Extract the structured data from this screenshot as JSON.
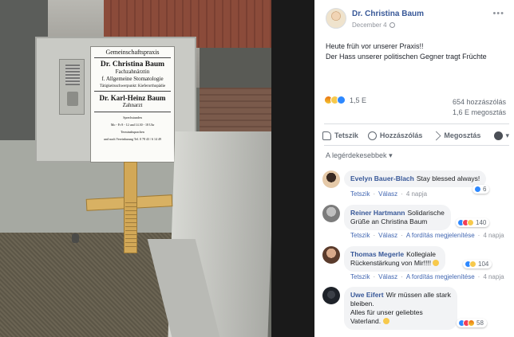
{
  "photo": {
    "sign": {
      "header": "Gemeinschaftspraxis",
      "doctor1_name": "Dr. Christina Baum",
      "doctor1_title_line1": "Fachzahnärztin",
      "doctor1_title_line2": "f. Allgemeine Stomatologie",
      "doctor1_note": "Tätigkeitsschwerpunkt: Kieferorthopädie",
      "doctor2_name": "Dr. Karl-Heinz Baum",
      "doctor2_title": "Zahnarzt",
      "hours_heading": "Sprechstunden",
      "hours_line1": "Mo - Fr   8 - 12 und 14.30 - 18 Uhr",
      "hours_line2": "Terminabsprachen",
      "hours_line3": "und nach Vereinbarung   Tel. 0 78 43 / 6 14 49"
    }
  },
  "post": {
    "author": "Dr. Christina Baum",
    "date": "December 4",
    "more_icon": "ellipsis-icon",
    "text_line1": "Heute früh vor unserer Praxis!!",
    "text_line2": "Der Hass unserer politischen Gegner tragt Früchte",
    "reactions": {
      "icons": [
        "angry",
        "sad",
        "like"
      ],
      "count": "1,5 E",
      "comments": "654 hozzászólás",
      "shares": "1,6 E megosztás"
    },
    "actions": {
      "like": "Tetszik",
      "comment": "Hozzászólás",
      "share": "Megosztás"
    },
    "sort_label": "A legérdekesebbek",
    "comments": [
      {
        "author": "Evelyn Bauer-Blach",
        "text": "Stay blessed always!",
        "like_label": "Tetszik",
        "reply_label": "Válasz",
        "time": "4 napja",
        "reaction_count": "6"
      },
      {
        "author": "Reiner Hartmann",
        "text_line1": "Solidarische",
        "text_line2": "Grüße an Christina Baum",
        "like_label": "Tetszik",
        "reply_label": "Válasz",
        "translate_label": "A fordítás megjelenítése",
        "time": "4 napja",
        "reaction_count": "140"
      },
      {
        "author": "Thomas Megerle",
        "text_line1": "Kollegiale",
        "text_line2": "Rückenstärkung von Mir!!!!",
        "like_label": "Tetszik",
        "reply_label": "Válasz",
        "translate_label": "A fordítás megjelenítése",
        "time": "4 napja",
        "reaction_count": "104"
      },
      {
        "author": "Uwe Eifert",
        "text_line1": "Wir müssen alle stark",
        "text_line2": "bleiben.",
        "text_line3": "Alles für unser geliebtes",
        "text_line4": "Vaterland.",
        "reaction_count": "58"
      }
    ]
  }
}
